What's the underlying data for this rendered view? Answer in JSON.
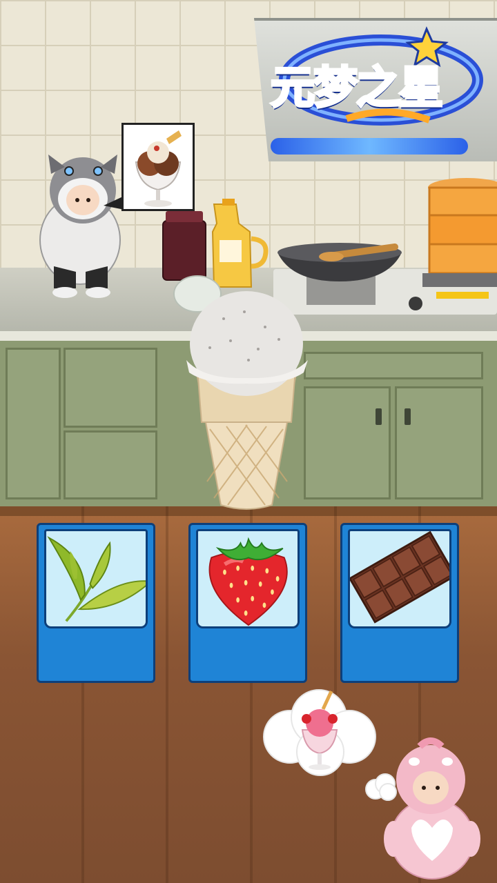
{
  "app": {
    "logo_text": "元梦之星"
  },
  "order_request": {
    "dessert": "chocolate-sundae-icon"
  },
  "ingredient_cards": [
    {
      "icon": "tea-leaf-icon"
    },
    {
      "icon": "strawberry-icon"
    },
    {
      "icon": "chocolate-bar-icon"
    }
  ],
  "customer_request": {
    "dessert": "strawberry-sundae-icon"
  },
  "colors": {
    "card_blue": "#1f84d6",
    "card_border": "#0d3f7a",
    "logo_blue": "#2f63ff"
  }
}
